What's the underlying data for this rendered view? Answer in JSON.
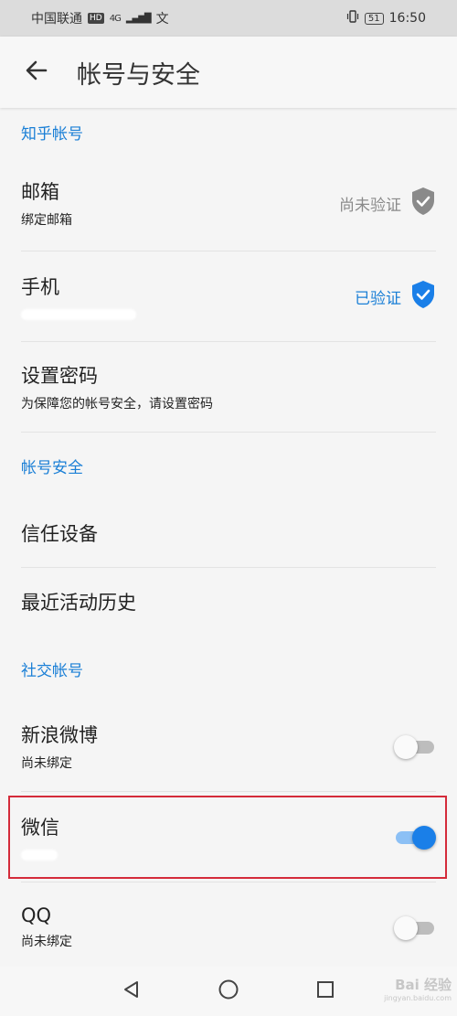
{
  "status_bar": {
    "carrier": "中国联通",
    "hd": "HD",
    "network": "4G",
    "extra_icon": "文",
    "battery": "51",
    "time": "16:50"
  },
  "app_bar": {
    "title": "帐号与安全",
    "back_icon": "arrow-left-icon"
  },
  "sections": {
    "zhihu_account": {
      "header": "知乎帐号",
      "email": {
        "title": "邮箱",
        "subtitle": "绑定邮箱",
        "status": "尚未验证",
        "icon": "shield-check-icon",
        "status_color": "#8a8a8a"
      },
      "phone": {
        "title": "手机",
        "status": "已验证",
        "icon": "shield-check-icon",
        "status_color": "#1a7fd6"
      },
      "password": {
        "title": "设置密码",
        "subtitle": "为保障您的帐号安全，请设置密码"
      }
    },
    "account_security": {
      "header": "帐号安全",
      "trusted_devices": {
        "title": "信任设备"
      },
      "activity_history": {
        "title": "最近活动历史"
      }
    },
    "social_accounts": {
      "header": "社交帐号",
      "weibo": {
        "title": "新浪微博",
        "subtitle": "尚未绑定",
        "enabled": false
      },
      "wechat": {
        "title": "微信",
        "enabled": true
      },
      "qq": {
        "title": "QQ",
        "subtitle": "尚未绑定",
        "enabled": false
      }
    }
  },
  "nav_bar": {
    "back": "triangle-back-icon",
    "home": "circle-home-icon",
    "recents": "square-recents-icon"
  },
  "watermark": {
    "text": "Bai 经验",
    "sub": "jingyan.baidu.com"
  },
  "colors": {
    "accent": "#1a7fd6",
    "highlight": "#d42b3a"
  }
}
